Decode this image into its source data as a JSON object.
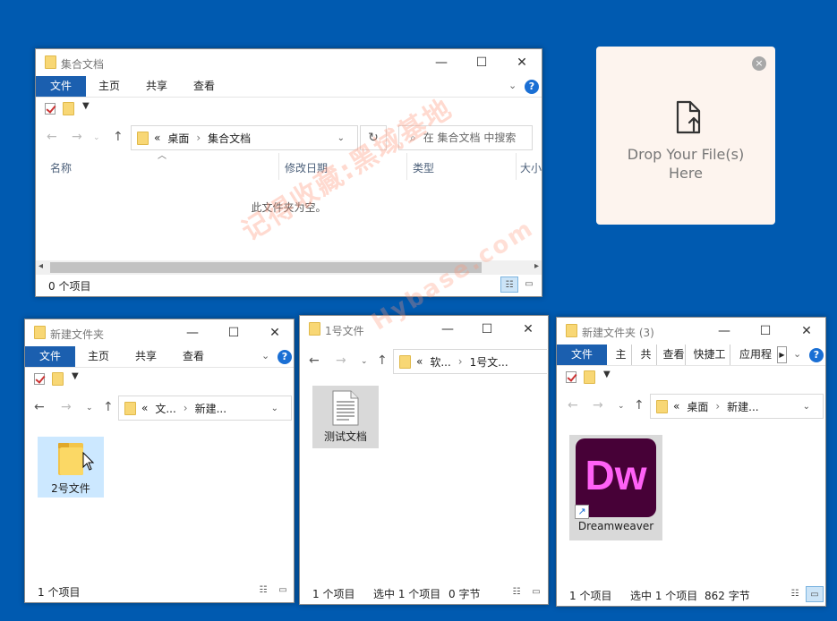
{
  "colors": {
    "desktop": "#005ab0",
    "file_tab": "#1b5faf",
    "selection": "#cce8ff",
    "dw_bg": "#470137",
    "dw_text": "#ff61f6"
  },
  "win1": {
    "title": "集合文档",
    "tabs": [
      "文件",
      "主页",
      "共享",
      "查看"
    ],
    "address": {
      "chev": "«",
      "seg1": "桌面",
      "sep": "›",
      "seg2": "集合文档"
    },
    "search_placeholder": "在 集合文档 中搜索",
    "columns": [
      "名称",
      "修改日期",
      "类型",
      "大小"
    ],
    "empty_text": "此文件夹为空。",
    "status": "0 个项目"
  },
  "win2": {
    "title": "新建文件夹",
    "tabs": [
      "文件",
      "主页",
      "共享",
      "查看"
    ],
    "address": {
      "chev": "«",
      "seg1": "文...",
      "sep": "›",
      "seg2": "新建..."
    },
    "items": [
      {
        "name": "2号文件",
        "icon": "folder-icon"
      }
    ],
    "status": "1 个项目"
  },
  "win3": {
    "title": "1号文件",
    "address": {
      "chev": "«",
      "seg1": "软...",
      "sep": "›",
      "seg2": "1号文..."
    },
    "items": [
      {
        "name": "测试文档",
        "icon": "text-document-icon"
      }
    ],
    "status": "1 个项目",
    "selection": "选中 1 个项目",
    "size": "0 字节"
  },
  "win4": {
    "title": "新建文件夹 (3)",
    "tabs": [
      "文件",
      "主页",
      "共享",
      "查看",
      "快捷工具",
      "应用程序"
    ],
    "address": {
      "chev": "«",
      "seg1": "桌面",
      "sep": "›",
      "seg2": "新建..."
    },
    "items": [
      {
        "name": "Dreamweaver",
        "icon": "dreamweaver-shortcut-icon",
        "logo": "Dw"
      }
    ],
    "status": "1 个项目",
    "selection": "选中 1 个项目",
    "size": "862 字节"
  },
  "dropzone": {
    "line1": "Drop Your File(s)",
    "line2": "Here"
  },
  "watermark": {
    "line1": "记得收藏:黑域基地",
    "line2": "Hybase.com"
  },
  "window_controls": {
    "minimize": "—",
    "maximize": "☐",
    "close": "✕"
  }
}
